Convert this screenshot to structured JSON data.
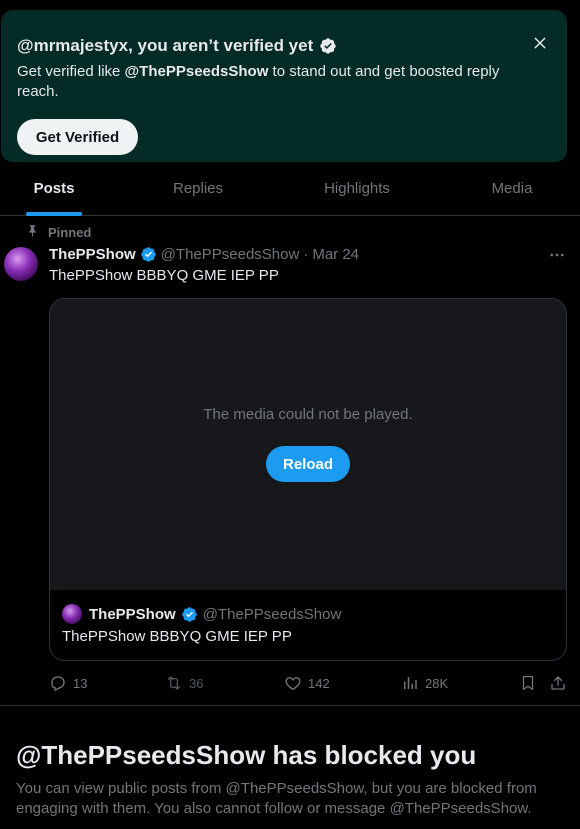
{
  "banner": {
    "title": "@mrmajestyx, you aren’t verified yet",
    "desc_prefix": "Get verified like ",
    "desc_handle": "@ThePPseedsShow",
    "desc_suffix": " to stand out and get boosted reply reach.",
    "button_label": "Get Verified",
    "close_icon": "close-icon"
  },
  "tabs": [
    {
      "label": "Posts",
      "active": true
    },
    {
      "label": "Replies",
      "active": false
    },
    {
      "label": "Highlights",
      "active": false
    },
    {
      "label": "Media",
      "active": false
    }
  ],
  "post": {
    "pinned_label": "Pinned",
    "name": "ThePPShow",
    "handle": "@ThePPseedsShow",
    "separator": "·",
    "date": "Mar 24",
    "text": "ThePPShow BBBYQ GME IEP PP",
    "media_message": "The media could not be played.",
    "reload_label": "Reload",
    "quote": {
      "name": "ThePPShow",
      "handle": "@ThePPseedsShow",
      "text": "ThePPShow BBBYQ GME IEP PP"
    },
    "actions": {
      "replies": "13",
      "reposts": "36",
      "likes": "142",
      "views": "28K"
    }
  },
  "blocked": {
    "title": "@ThePPseedsShow has blocked you",
    "desc": "You can view public posts from @ThePPseedsShow, but you are blocked from engaging with them. You also cannot follow or message @ThePPseedsShow."
  },
  "colors": {
    "accent": "#1d9bf0",
    "banner_bg": "#042b25",
    "muted": "#71767b",
    "text": "#e7e9ea",
    "border": "#2f3336"
  }
}
